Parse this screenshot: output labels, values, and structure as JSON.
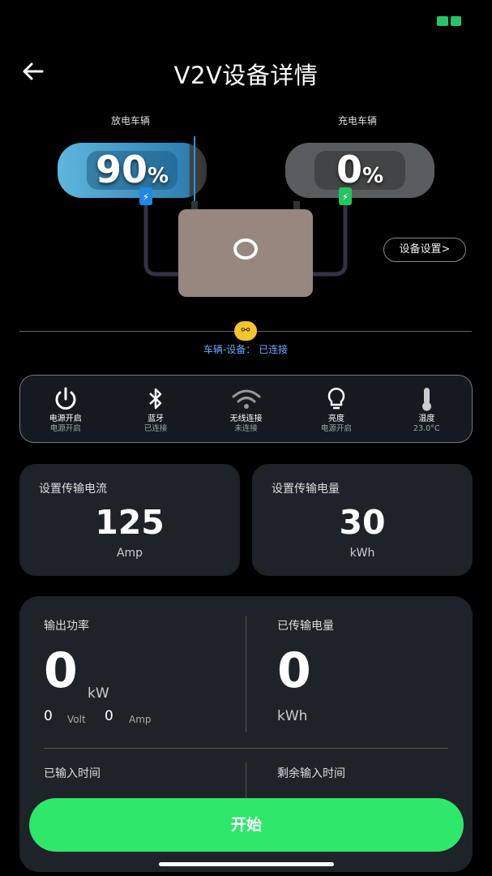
{
  "header": {
    "title": "V2V设备详情"
  },
  "vehicles": {
    "discharge": {
      "label": "放电车辆",
      "percent": "90",
      "unit": "%"
    },
    "charge": {
      "label": "充电车辆",
      "percent": "0",
      "unit": "%"
    }
  },
  "device_settings_label": "设备设置>",
  "connection_status": "车辆-设备： 已连接",
  "status_items": [
    {
      "icon": "power-icon",
      "label": "电源开启",
      "sub": "电源开启"
    },
    {
      "icon": "bluetooth-icon",
      "label": "蓝牙",
      "sub": "已连接"
    },
    {
      "icon": "wifi-icon",
      "label": "无线连接",
      "sub": "未连接"
    },
    {
      "icon": "lightbulb-icon",
      "label": "亮度",
      "sub": "电源开启"
    },
    {
      "icon": "thermometer-icon",
      "label": "温度",
      "sub": "23.0°C"
    }
  ],
  "current_card": {
    "title": "设置传输电流",
    "value": "125",
    "unit": "Amp"
  },
  "energy_card": {
    "title": "设置传输电量",
    "value": "30",
    "unit": "kWh"
  },
  "output": {
    "power_title": "输出功率",
    "power_value": "0",
    "power_unit": "kW",
    "volt_value": "0",
    "volt_unit": "Volt",
    "amp_value": "0",
    "amp_unit": "Amp",
    "transferred_title": "已传输电量",
    "transferred_value": "0",
    "transferred_unit": "kWh",
    "elapsed_title": "已输入时间",
    "remaining_title": "剩余输入时间"
  },
  "start_label": "开始",
  "colors": {
    "accent": "#2ee86b",
    "link_blue": "#6ea8ff",
    "charge_blue": "#1e88e5",
    "charge_green": "#22c55e"
  }
}
